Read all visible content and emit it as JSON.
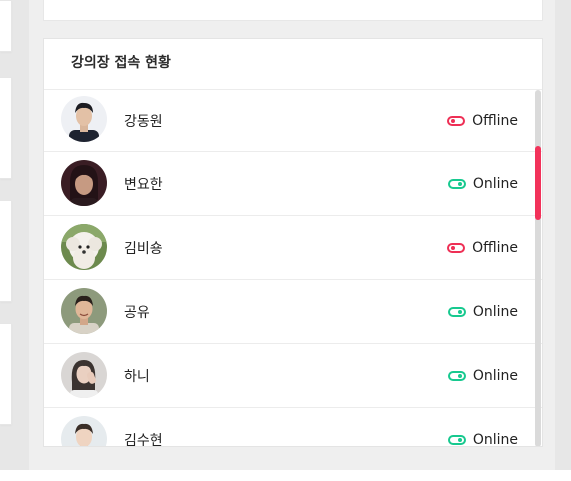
{
  "panel": {
    "title": "강의장 접속 현황"
  },
  "users": [
    {
      "name": "강동원",
      "status": "Offline",
      "online": false,
      "avatar_icon": "portrait-man-dark-hair"
    },
    {
      "name": "변요한",
      "status": "Online",
      "online": true,
      "avatar_icon": "portrait-man-long-hair"
    },
    {
      "name": "김비숑",
      "status": "Offline",
      "online": false,
      "avatar_icon": "white-bichon-dog"
    },
    {
      "name": "공유",
      "status": "Online",
      "online": true,
      "avatar_icon": "portrait-man-smiling"
    },
    {
      "name": "하니",
      "status": "Online",
      "online": true,
      "avatar_icon": "portrait-woman-posing"
    },
    {
      "name": "김수현",
      "status": "Online",
      "online": true,
      "avatar_icon": "portrait-man-light"
    }
  ],
  "colors": {
    "offline": "#ee2f55",
    "online": "#17c98f",
    "scroll_thumb": "#f2325a"
  }
}
